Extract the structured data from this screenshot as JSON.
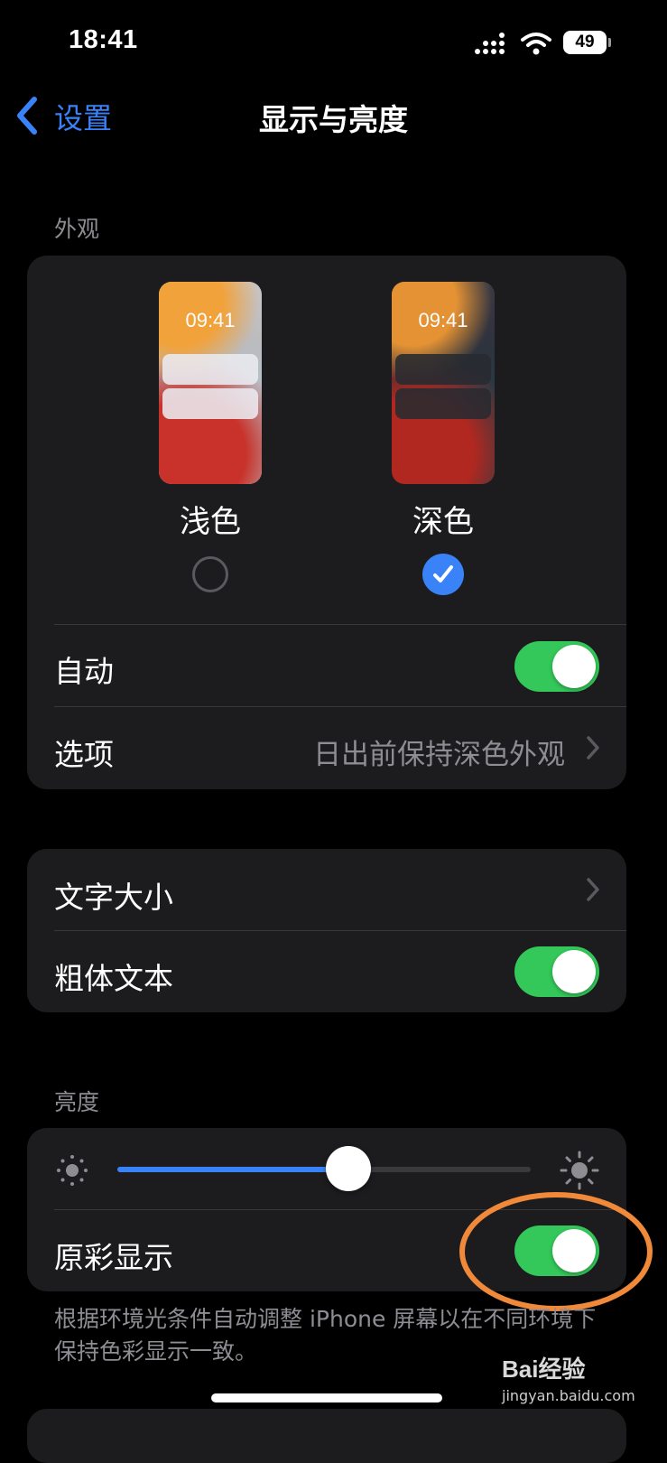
{
  "status_bar": {
    "time": "18:41",
    "battery": "49"
  },
  "nav": {
    "back_label": "设置",
    "title": "显示与亮度"
  },
  "appearance": {
    "section_label": "外观",
    "light": {
      "clock": "09:41",
      "label": "浅色",
      "selected": false
    },
    "dark": {
      "clock": "09:41",
      "label": "深色",
      "selected": true
    },
    "auto": {
      "label": "自动",
      "on": true
    },
    "options": {
      "label": "选项",
      "value": "日出前保持深色外观"
    }
  },
  "text": {
    "text_size": {
      "label": "文字大小"
    },
    "bold_text": {
      "label": "粗体文本",
      "on": true
    }
  },
  "brightness": {
    "section_label": "亮度",
    "level": 0.56,
    "true_tone": {
      "label": "原彩显示",
      "on": true
    },
    "footnote": "根据环境光条件自动调整 iPhone 屏幕以在不同环境下保持色彩显示一致。"
  },
  "highlight_color": "#f0893a",
  "watermark": {
    "brand": "Bai经验",
    "url": "jingyan.baidu.com"
  },
  "icons": [
    "chevron-left-icon",
    "chevron-right-icon",
    "checkmark-icon",
    "sun-small-icon",
    "sun-large-icon",
    "wifi-icon",
    "signal-icon",
    "battery-icon"
  ]
}
